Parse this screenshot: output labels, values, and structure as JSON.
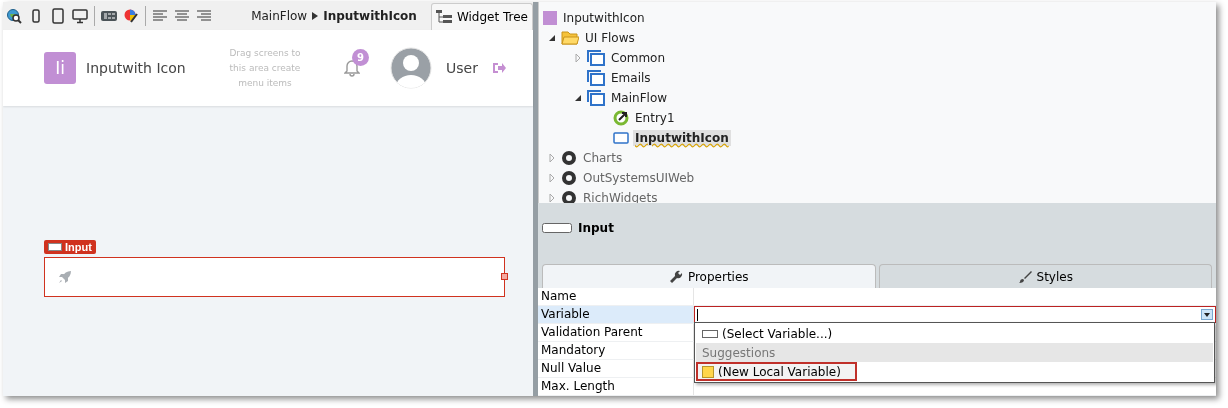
{
  "toolbar": {
    "icons": [
      {
        "kind": "web"
      },
      {
        "kind": "phone"
      },
      {
        "kind": "tablet"
      },
      {
        "kind": "desktop"
      },
      {
        "kind": "css"
      },
      {
        "kind": "theme"
      },
      {
        "kind": "align-left"
      },
      {
        "kind": "align-center"
      },
      {
        "kind": "align-right"
      }
    ],
    "breadcrumb": [
      "MainFlow",
      "InputwithIcon"
    ],
    "widget_tree_tab": "Widget Tree"
  },
  "preview": {
    "logo_letter": "Ii",
    "app_name": "Inputwith Icon",
    "menu_hint": "Drag screens to this area create menu items",
    "notification_count": "9",
    "user_name": "User"
  },
  "canvas": {
    "widget_label": "Input",
    "input_selected": true
  },
  "tree": {
    "label": "InputwithIcon",
    "kind": "module",
    "children": [
      {
        "label": "UI Flows",
        "kind": "folder",
        "expanded": true,
        "selected": false,
        "children": [
          {
            "label": "Common",
            "kind": "flow",
            "expanded": false,
            "selected": false
          },
          {
            "label": "Emails",
            "kind": "flow",
            "selected": false
          },
          {
            "label": "MainFlow",
            "kind": "flow",
            "expanded": true,
            "selected": false,
            "children": [
              {
                "label": "Entry1",
                "kind": "entry",
                "selected": false
              },
              {
                "label": "InputwithIcon",
                "kind": "screen",
                "selected": true
              }
            ]
          }
        ]
      },
      {
        "label": "Charts",
        "kind": "dependency",
        "expanded": false,
        "selected": false
      },
      {
        "label": "OutSystemsUIWeb",
        "kind": "dependency",
        "expanded": false,
        "selected": false
      },
      {
        "label": "RichWidgets",
        "kind": "dependency",
        "expanded": false,
        "selected": false
      }
    ]
  },
  "properties": {
    "widget": "Input",
    "tabs": [
      {
        "label": "Properties",
        "kind": "wrench",
        "selected": true
      },
      {
        "label": "Styles",
        "kind": "brush",
        "selected": false
      }
    ],
    "rows": [
      {
        "name": "Name",
        "selected": false
      },
      {
        "name": "Variable",
        "selected": true
      },
      {
        "name": "Validation Parent",
        "selected": false
      },
      {
        "name": "Mandatory",
        "selected": false
      },
      {
        "name": "Null Value",
        "selected": false
      },
      {
        "name": "Max. Length",
        "selected": false
      }
    ],
    "dropdown": [
      {
        "kind": "option",
        "label": "(Select Variable...)",
        "highlighted": false
      },
      {
        "kind": "header",
        "label": "Suggestions",
        "highlighted": false
      },
      {
        "kind": "new",
        "label": "(New Local Variable)",
        "highlighted": true
      }
    ]
  }
}
